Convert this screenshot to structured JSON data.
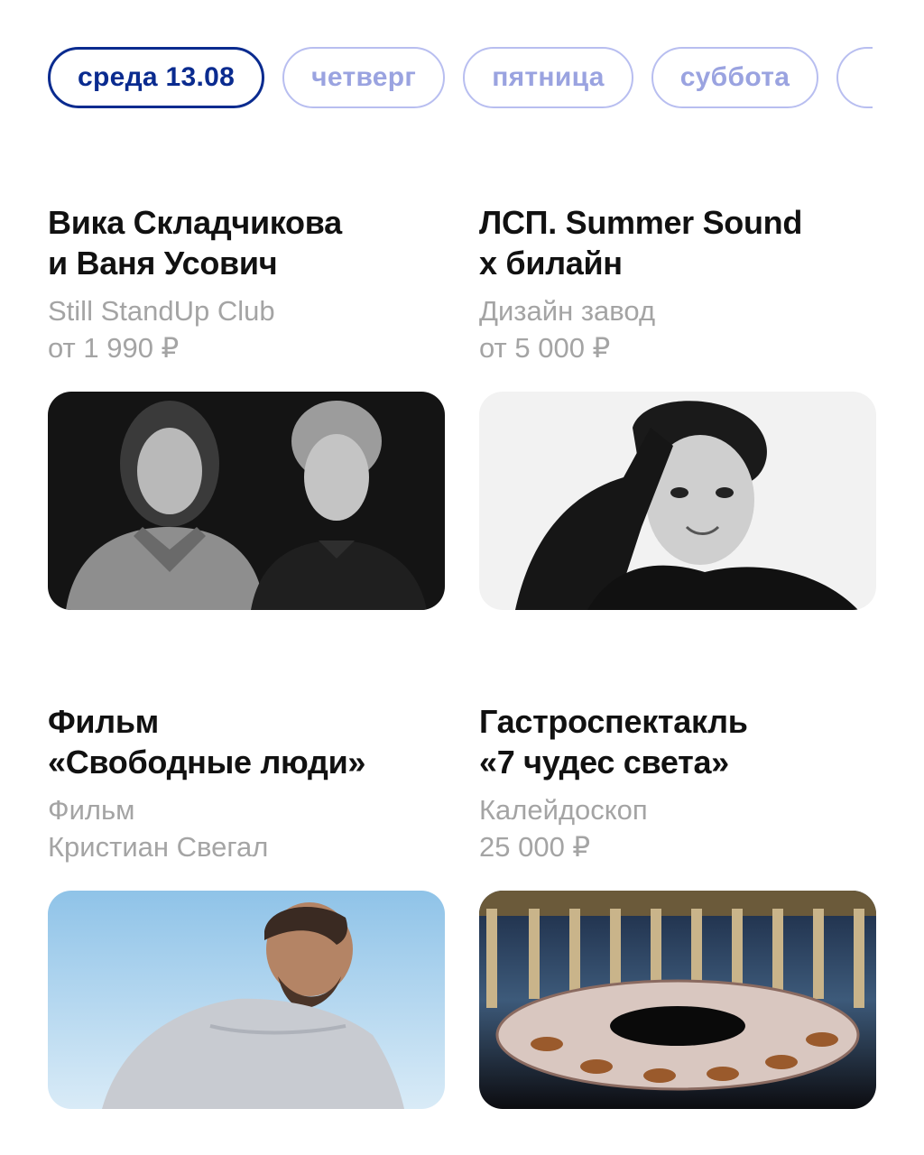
{
  "day_tabs": [
    {
      "label": "среда 13.08",
      "active": true
    },
    {
      "label": "четверг",
      "active": false
    },
    {
      "label": "пятница",
      "active": false
    },
    {
      "label": "суббота",
      "active": false
    }
  ],
  "events": [
    {
      "title": [
        "Вика Складчикова",
        "и Ваня Усович"
      ],
      "venue": "Still StandUp Club",
      "price": "от 1 990 ₽",
      "image": "two-comedians-bw-photo"
    },
    {
      "title": [
        "ЛСП. Summer Sound",
        "x билайн"
      ],
      "venue": "Дизайн завод",
      "price": "от 5 000 ₽",
      "image": "singer-bw-portrait"
    },
    {
      "title": [
        "Фильм",
        "«Свободные люди»"
      ],
      "venue": "Фильм",
      "price": "Кристиан Свегал",
      "image": "man-on-sky-background"
    },
    {
      "title": [
        "Гастроспектакль",
        "«7 чудес света»"
      ],
      "venue": "Калейдоскоп",
      "price": "25 000 ₽",
      "image": "round-stage-colonnade"
    }
  ],
  "colors": {
    "accent": "#0a2b8f",
    "inactive": "#9aa3e0",
    "muted": "#a4a4a4"
  }
}
